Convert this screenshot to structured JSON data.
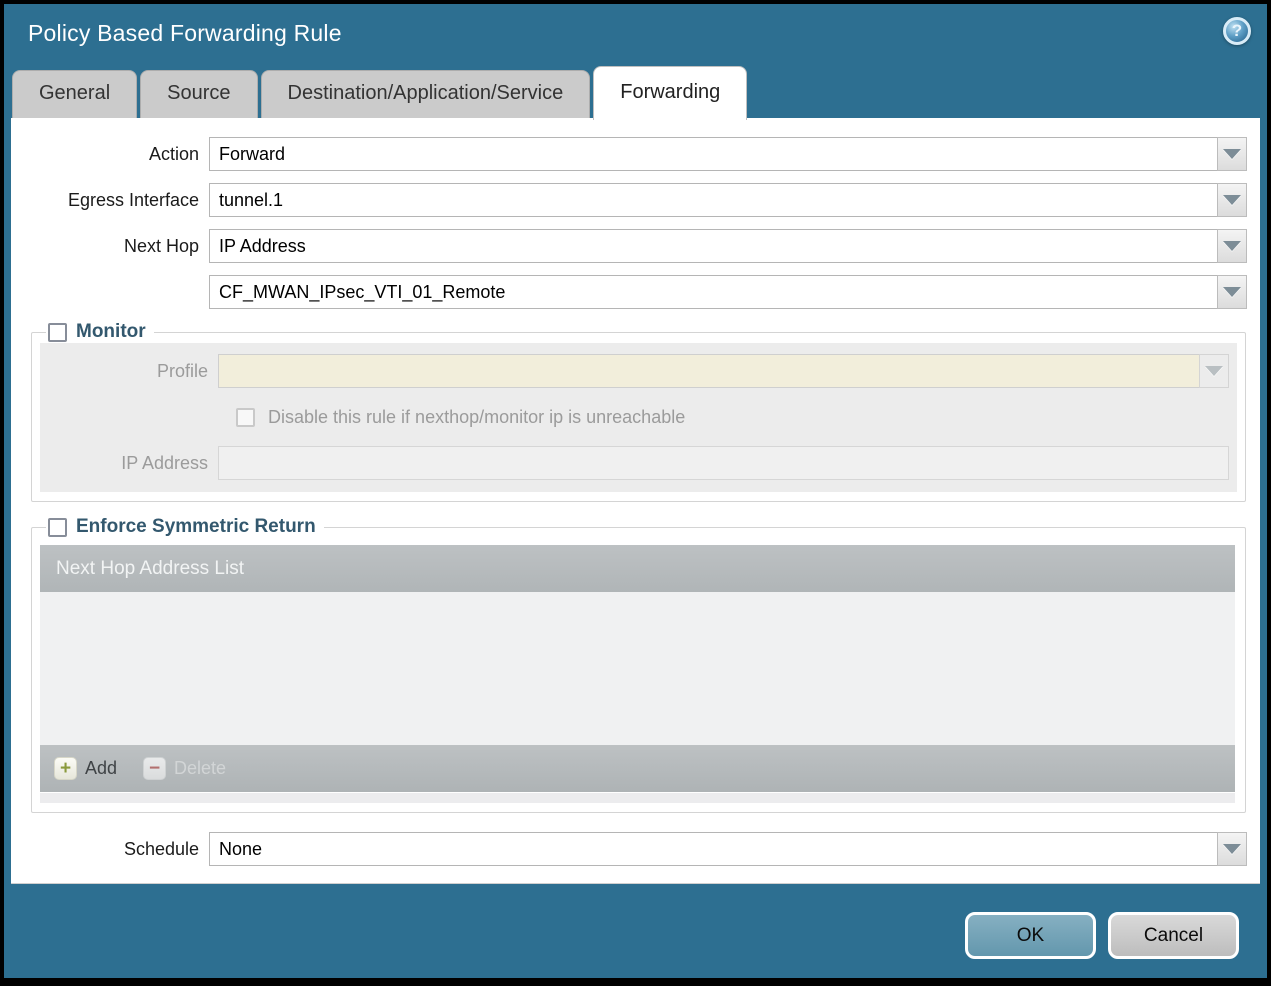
{
  "window": {
    "title": "Policy Based Forwarding Rule"
  },
  "icons": {
    "help": "?",
    "add": "+",
    "delete": "−"
  },
  "tabs": [
    {
      "label": "General",
      "active": false
    },
    {
      "label": "Source",
      "active": false
    },
    {
      "label": "Destination/Application/Service",
      "active": false
    },
    {
      "label": "Forwarding",
      "active": true
    }
  ],
  "form": {
    "action": {
      "label": "Action",
      "value": "Forward"
    },
    "egress_interface": {
      "label": "Egress Interface",
      "value": "tunnel.1"
    },
    "next_hop": {
      "label": "Next Hop",
      "value": "IP Address"
    },
    "next_hop_address": {
      "value": "CF_MWAN_IPsec_VTI_01_Remote"
    },
    "schedule": {
      "label": "Schedule",
      "value": "None"
    }
  },
  "monitor_section": {
    "legend": "Monitor",
    "checked": false,
    "profile": {
      "label": "Profile",
      "value": ""
    },
    "disable_rule": {
      "label": "Disable this rule if nexthop/monitor ip is unreachable",
      "checked": false
    },
    "ip_address": {
      "label": "IP Address",
      "value": ""
    }
  },
  "symmetric_return_section": {
    "legend": "Enforce Symmetric Return",
    "checked": false,
    "table": {
      "header": "Next Hop Address List",
      "rows": []
    },
    "toolbar": {
      "add_label": "Add",
      "delete_label": "Delete",
      "delete_enabled": false
    }
  },
  "footer": {
    "ok_label": "OK",
    "cancel_label": "Cancel"
  },
  "colors": {
    "titlebar_teal": "#2d6f91",
    "inactive_tab_gray": "#cbcbcb",
    "active_tab_white": "#ffffff",
    "disabled_field_beige": "#f2eedb",
    "section_panel_gray": "#ececec",
    "table_bar_gray": "#b3b8ba",
    "table_body_gray": "#f0f1f2",
    "legend_text": "#33586e",
    "ok_button_teal": "#76a4b8",
    "cancel_button_gray": "#c9c9c9",
    "add_plus_green": "#8a9a3c",
    "delete_minus_red": "#b2706f"
  }
}
